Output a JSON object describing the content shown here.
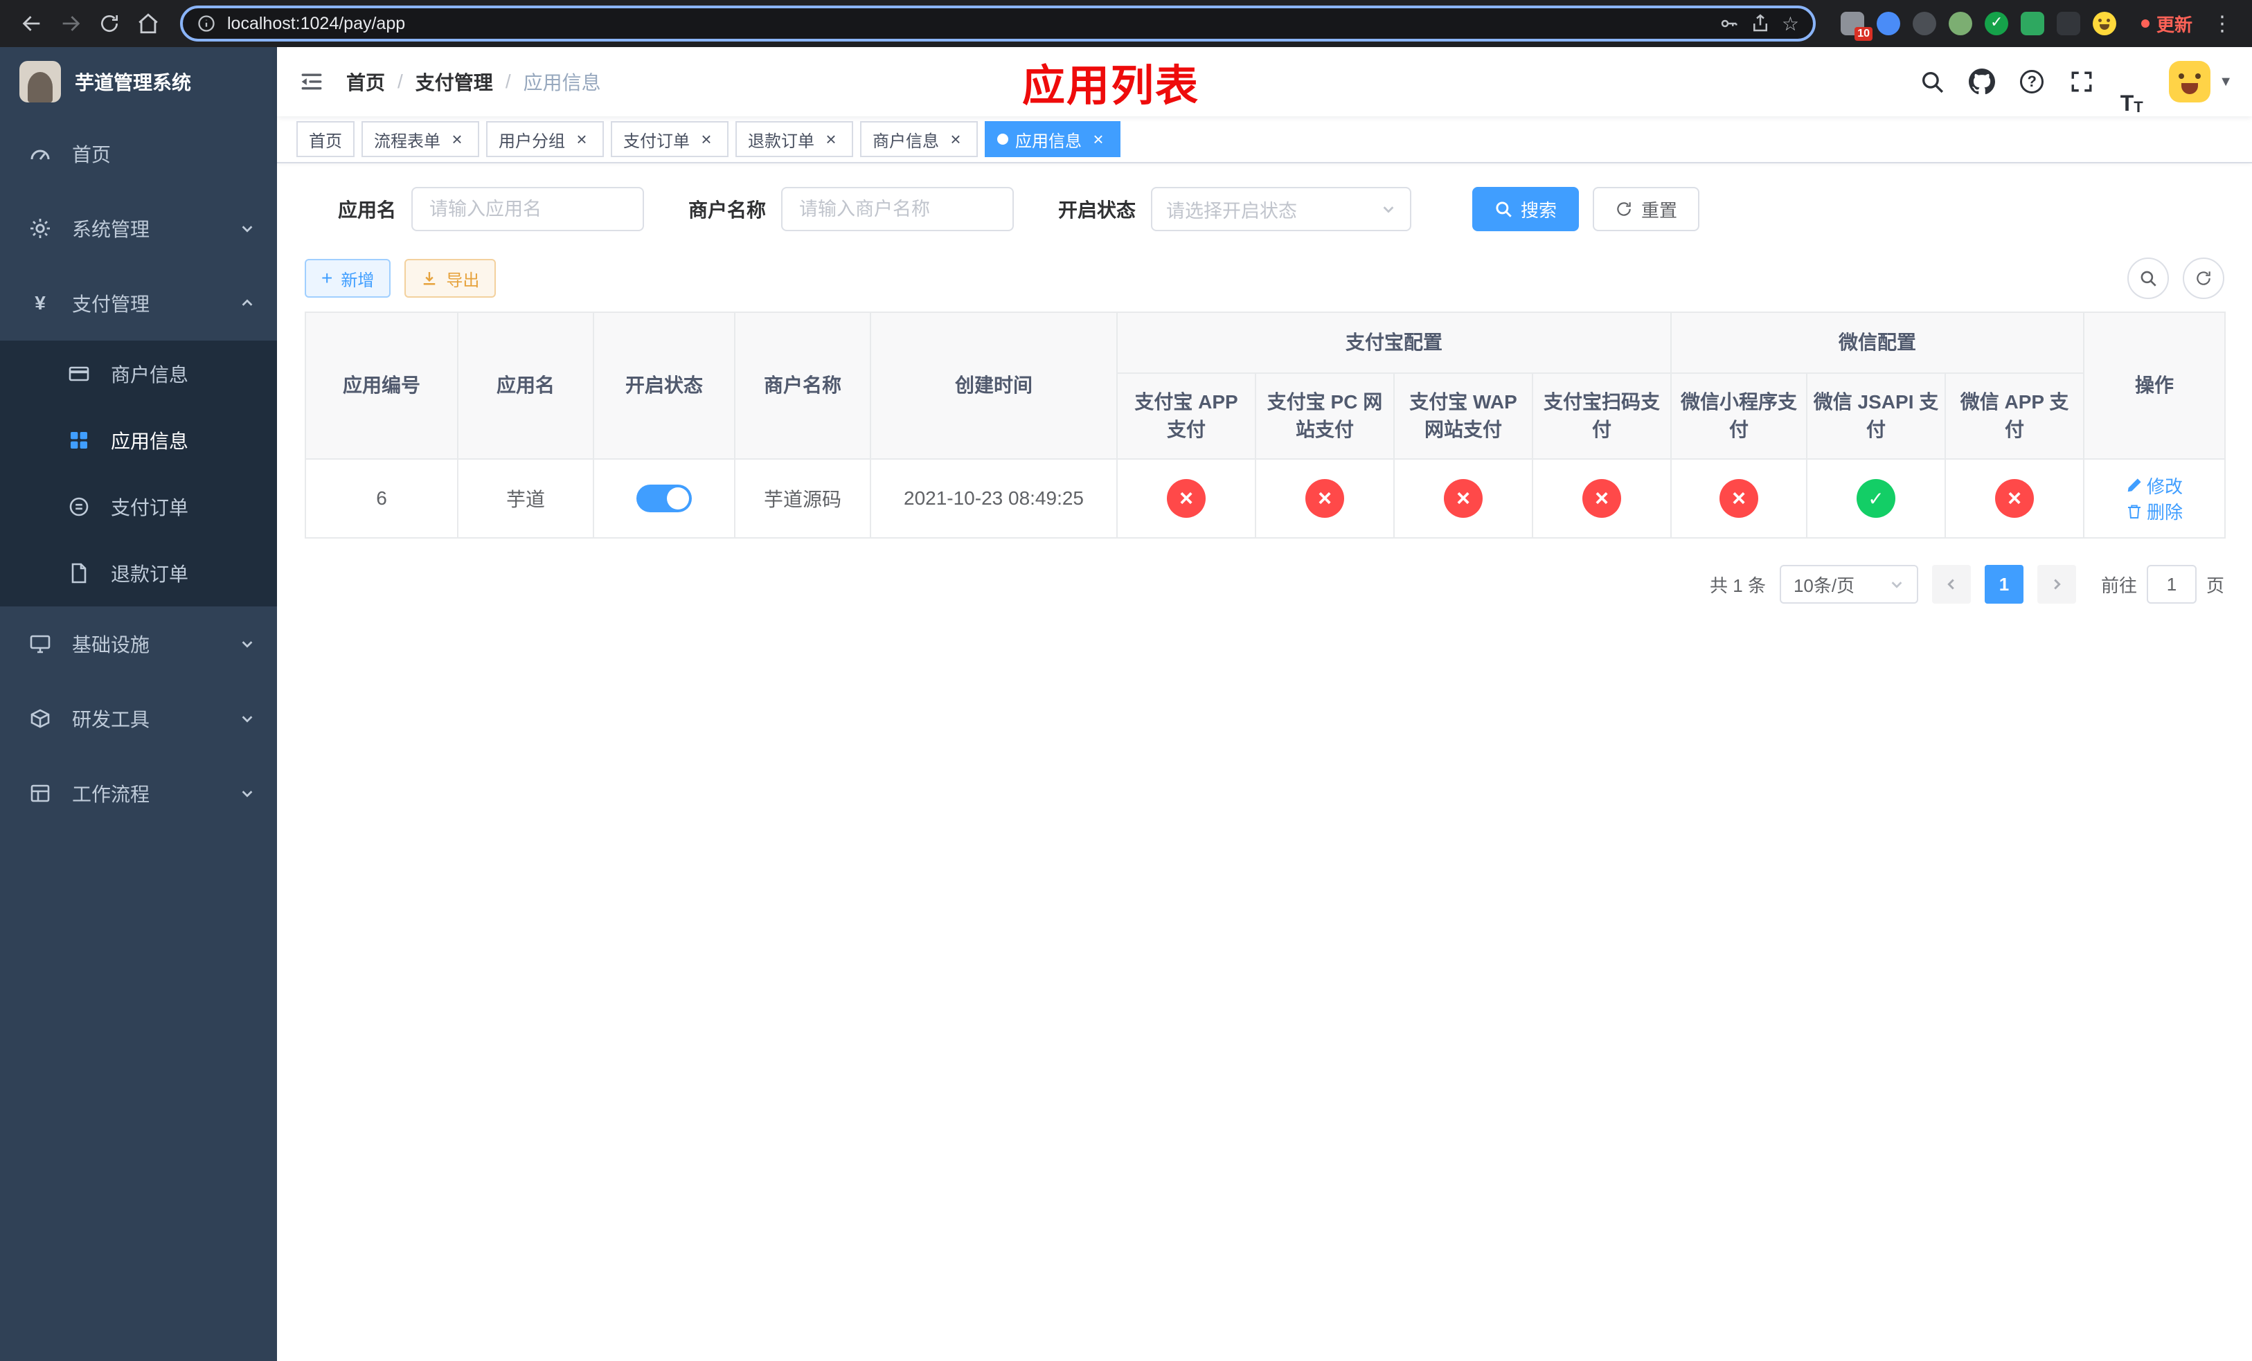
{
  "theme": {
    "accent": "#409eff",
    "danger": "#ff4949",
    "success": "#13ce66",
    "warning": "#e6a23c",
    "sidebar_bg": "#304156",
    "submenu_bg": "#1f2d3d"
  },
  "browser": {
    "url": "localhost:1024/pay/app",
    "update_label": "更新",
    "extension_badge": "10"
  },
  "sidebar": {
    "title": "芋道管理系统",
    "items": [
      {
        "label": "首页"
      },
      {
        "label": "系统管理"
      },
      {
        "label": "支付管理",
        "children": [
          {
            "label": "商户信息"
          },
          {
            "label": "应用信息",
            "active": true
          },
          {
            "label": "支付订单"
          },
          {
            "label": "退款订单"
          }
        ]
      },
      {
        "label": "基础设施"
      },
      {
        "label": "研发工具"
      },
      {
        "label": "工作流程"
      }
    ]
  },
  "header": {
    "breadcrumb": [
      "首页",
      "支付管理",
      "应用信息"
    ],
    "overlay_title": "应用列表"
  },
  "tabs": [
    {
      "label": "首页"
    },
    {
      "label": "流程表单"
    },
    {
      "label": "用户分组"
    },
    {
      "label": "支付订单"
    },
    {
      "label": "退款订单"
    },
    {
      "label": "商户信息"
    },
    {
      "label": "应用信息",
      "active": true
    }
  ],
  "filters": {
    "app_name_label": "应用名",
    "app_name_placeholder": "请输入应用名",
    "merchant_label": "商户名称",
    "merchant_placeholder": "请输入商户名称",
    "status_label": "开启状态",
    "status_placeholder": "请选择开启状态",
    "search_label": "搜索",
    "reset_label": "重置"
  },
  "toolbar": {
    "add_label": "新增",
    "export_label": "导出"
  },
  "table": {
    "groups": {
      "alipay": "支付宝配置",
      "wechat": "微信配置"
    },
    "columns": [
      "应用编号",
      "应用名",
      "开启状态",
      "商户名称",
      "创建时间",
      "支付宝 APP 支付",
      "支付宝 PC 网站支付",
      "支付宝 WAP 网站支付",
      "支付宝扫码支付",
      "微信小程序支付",
      "微信 JSAPI 支付",
      "微信 APP 支付",
      "操作"
    ],
    "rows": [
      {
        "id": "6",
        "name": "芋道",
        "enabled": true,
        "merchant": "芋道源码",
        "created_at": "2021-10-23 08:49:25",
        "alipay_app": false,
        "alipay_pc": false,
        "alipay_wap": false,
        "alipay_qr": false,
        "wechat_mini": false,
        "wechat_jsapi": true,
        "wechat_app": false,
        "edit_label": "修改",
        "delete_label": "删除"
      }
    ]
  },
  "pagination": {
    "total_text": "共 1 条",
    "page_size_text": "10条/页",
    "current_page": "1",
    "goto_label": "前往",
    "goto_value": "1",
    "unit_label": "页"
  }
}
